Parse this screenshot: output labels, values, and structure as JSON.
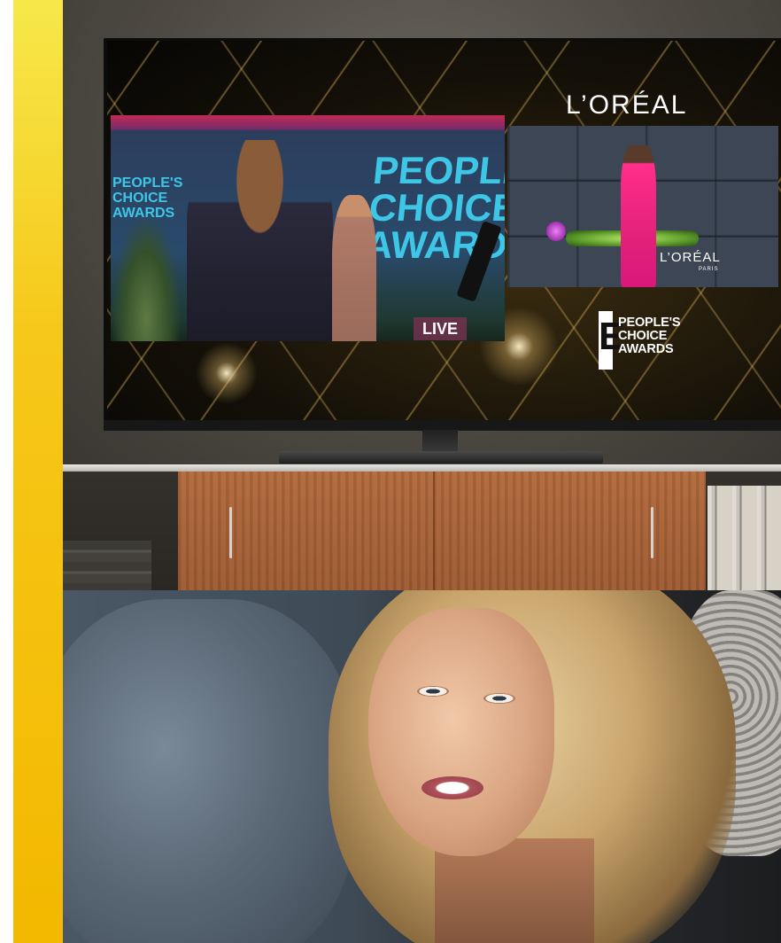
{
  "tv": {
    "sponsor_logo": "L’ORÉAL",
    "live_label": "LIVE",
    "backdrop_text": "PEOPLE'S CHOICE AWARDS",
    "backdrop_small_text": "PEOPLE'S CHOICE AWARDS",
    "ad": {
      "brand": "L’ORÉAL",
      "brand_sub": "PARIS"
    },
    "show_logo": {
      "mark": "E",
      "line1": "PEOPLE'S",
      "line2": "CHOICE",
      "line3": "AWARDS"
    }
  },
  "colors": {
    "accent_yellow": "#f6c81a",
    "backdrop_cyan": "#3ec6e6",
    "ad_pink": "#ff2e8a",
    "gold": "#d4aa50"
  }
}
